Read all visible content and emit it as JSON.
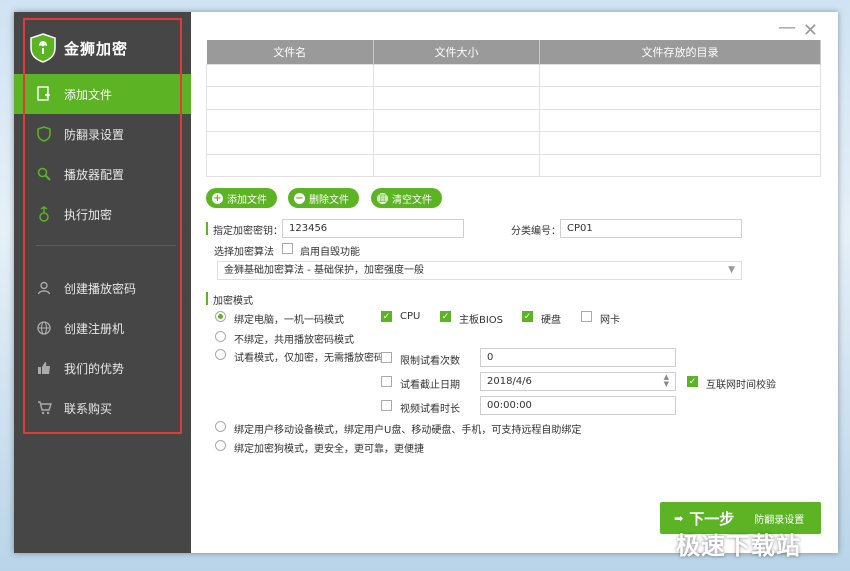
{
  "app": {
    "title": "金狮加密"
  },
  "sidebar": {
    "items": [
      {
        "label": "添加文件",
        "icon": "add-file-icon",
        "active": true
      },
      {
        "label": "防翻录设置",
        "icon": "shield-icon"
      },
      {
        "label": "播放器配置",
        "icon": "search-icon"
      },
      {
        "label": "执行加密",
        "icon": "encrypt-icon"
      },
      {
        "label": "创建播放密码",
        "icon": "user-icon"
      },
      {
        "label": "创建注册机",
        "icon": "globe-icon"
      },
      {
        "label": "我们的优势",
        "icon": "thumbs-up-icon"
      },
      {
        "label": "联系购买",
        "icon": "cart-icon"
      }
    ]
  },
  "window_controls": {
    "minimize": "—",
    "close": "✕"
  },
  "file_table": {
    "columns": [
      "文件名",
      "文件大小",
      "文件存放的目录"
    ],
    "rows": [
      [
        "",
        "",
        ""
      ],
      [
        "",
        "",
        ""
      ],
      [
        "",
        "",
        ""
      ],
      [
        "",
        "",
        ""
      ],
      [
        "",
        "",
        ""
      ]
    ]
  },
  "toolbar": {
    "add_label": "添加文件",
    "add_icon": "+",
    "delete_label": "删除文件",
    "delete_icon": "−",
    "clear_label": "清空文件",
    "clear_icon": "▥"
  },
  "form": {
    "key_label": "指定加密密钥：",
    "key_value": "123456",
    "category_label": "分类编号：",
    "category_value": "CP01",
    "algorithm_label": "选择加密算法",
    "self_destruct_label": "启用自毁功能",
    "algorithm_value": "金狮基础加密算法 - 基础保护，加密强度一般",
    "mode_label": "加密模式",
    "modes": [
      "绑定电脑，一机一码模式",
      "不绑定，共用播放密码模式",
      "试看模式，仅加密，无需播放密码",
      "绑定用户移动设备模式，绑定用户U盘、移动硬盘、手机，可支持远程自助绑定",
      "绑定加密狗模式，更安全，更可靠，更便捷"
    ],
    "bind_options": [
      "CPU",
      "主板BIOS",
      "硬盘",
      "网卡"
    ],
    "trial": {
      "limit_count_label": "限制试看次数",
      "limit_count_value": "0",
      "end_date_label": "试看截止日期",
      "end_date_value": "2018/4/6",
      "internet_check_label": "互联网时间校验",
      "duration_label": "视频试看时长",
      "duration_value": "00:00:00"
    }
  },
  "next_button": {
    "label": "下一步",
    "sub_label": "防翻录设置",
    "icon": "➡"
  },
  "watermark": "极速下载站",
  "colors": {
    "accent": "#5cb323",
    "sidebar_bg": "#464646",
    "outline": "#e03a3a"
  }
}
